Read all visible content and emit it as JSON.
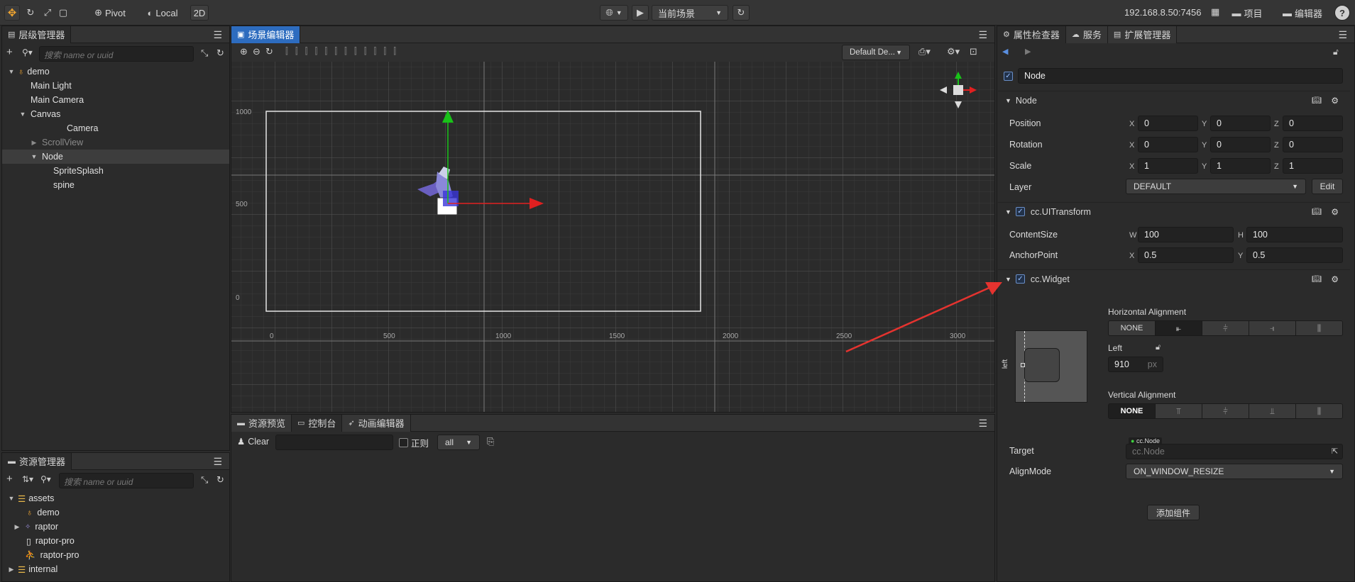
{
  "toolbar": {
    "pivot": "Pivot",
    "local": "Local",
    "mode2d": "2D",
    "scene_select": "当前场景",
    "ip": "192.168.8.50:7456",
    "project": "项目",
    "editor": "编辑器",
    "help": "?"
  },
  "hierarchy": {
    "title": "层级管理器",
    "search_placeholder": "搜索 name or uuid",
    "items": [
      {
        "label": "demo"
      },
      {
        "label": "Main Light"
      },
      {
        "label": "Main Camera"
      },
      {
        "label": "Canvas"
      },
      {
        "label": "Camera"
      },
      {
        "label": "ScrollView"
      },
      {
        "label": "Node"
      },
      {
        "label": "SpriteSplash"
      },
      {
        "label": "spine"
      }
    ]
  },
  "assets": {
    "title": "资源管理器",
    "search_placeholder": "搜索 name or uuid",
    "items": [
      {
        "label": "assets"
      },
      {
        "label": "demo"
      },
      {
        "label": "raptor"
      },
      {
        "label": "raptor-pro"
      },
      {
        "label": "raptor-pro"
      },
      {
        "label": "internal"
      }
    ]
  },
  "scene": {
    "tab": "场景编辑器",
    "camera_select": "Default De...",
    "y_labels": [
      "1000",
      "500",
      "0"
    ],
    "x_labels": [
      "0",
      "500",
      "1000",
      "1500",
      "2000",
      "2500",
      "3000"
    ]
  },
  "bottom": {
    "tabs": [
      "资源预览",
      "控制台",
      "动画编辑器"
    ],
    "clear": "Clear",
    "regex": "正则",
    "filter": "all"
  },
  "inspector": {
    "tabs": [
      "属性检查器",
      "服务",
      "扩展管理器"
    ],
    "node_name": "Node",
    "node_section": "Node",
    "position": {
      "label": "Position",
      "x": "0",
      "y": "0",
      "z": "0"
    },
    "rotation": {
      "label": "Rotation",
      "x": "0",
      "y": "0",
      "z": "0"
    },
    "scale": {
      "label": "Scale",
      "x": "1",
      "y": "1",
      "z": "1"
    },
    "layer": {
      "label": "Layer",
      "value": "DEFAULT",
      "edit": "Edit"
    },
    "uitransform": "cc.UITransform",
    "content_size": {
      "label": "ContentSize",
      "w_axis": "W",
      "h_axis": "H",
      "w": "100",
      "h": "100"
    },
    "anchor": {
      "label": "AnchorPoint",
      "x": "0.5",
      "y": "0.5"
    },
    "widget": "cc.Widget",
    "h_align": "Horizontal Alignment",
    "h_none": "NONE",
    "left_label": "Left",
    "left_value": "910",
    "left_unit": "px",
    "side_left": "left",
    "v_align": "Vertical Alignment",
    "v_none": "NONE",
    "target": {
      "label": "Target",
      "tag": "cc.Node",
      "value": "cc.Node"
    },
    "align_mode": {
      "label": "AlignMode",
      "value": "ON_WINDOW_RESIZE"
    },
    "add_component": "添加组件",
    "axis": {
      "x": "X",
      "y": "Y",
      "z": "Z"
    }
  },
  "colors": {
    "accent_blue": "#2d6cbf",
    "gizmo_green": "#19c319",
    "gizmo_red": "#e02020",
    "annotation_arrow": "#e5332f",
    "check_blue": "#6a8fc8"
  }
}
